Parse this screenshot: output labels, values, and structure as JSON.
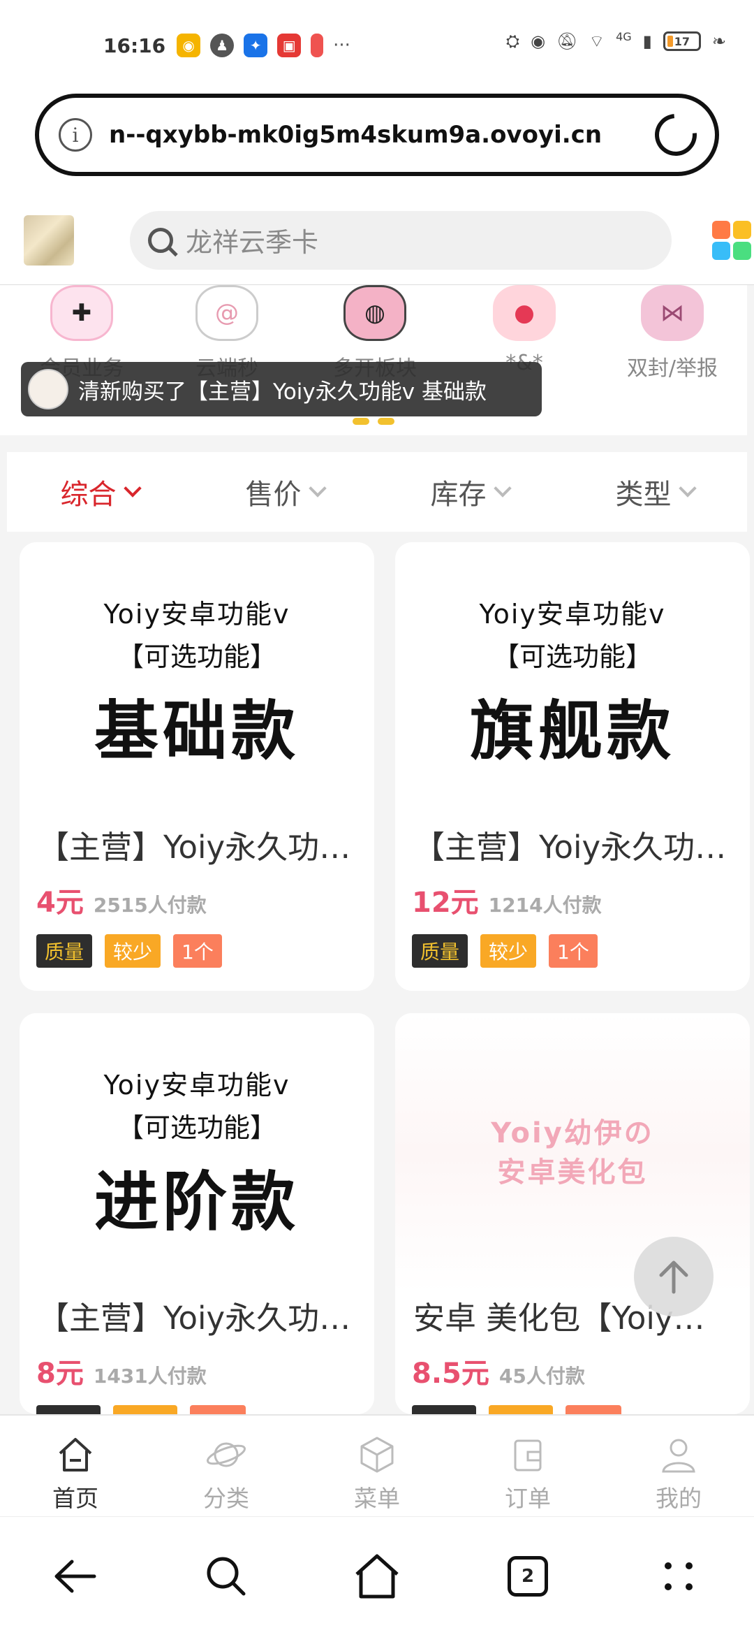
{
  "status": {
    "time": "16:16",
    "network": "4G",
    "battery": "17"
  },
  "browser": {
    "url": "n--qxybb-mk0ig5m4skum9a.ovoyi.cn",
    "tab_count": "2"
  },
  "search": {
    "placeholder": "龙祥云季卡"
  },
  "categories": [
    {
      "label": "会员业务",
      "icon": "cross-heart-icon"
    },
    {
      "label": "云端秒",
      "icon": "swirl-icon"
    },
    {
      "label": "多开板块",
      "icon": "pacifier-icon"
    },
    {
      "label": "*&*",
      "icon": "apple-icon"
    },
    {
      "label": "双封/举报",
      "icon": "bow-icon"
    }
  ],
  "toast": {
    "text": "清新购买了【主营】Yoiy永久功能v 基础款"
  },
  "sort": {
    "items": [
      "综合",
      "售价",
      "库存",
      "类型"
    ],
    "active_color": "#d9262c"
  },
  "products": [
    {
      "img_line1": "Yoiy安卓功能v",
      "img_line2": "【可选功能】",
      "img_line3": "基础款",
      "title": "【主营】Yoiy永久功能v 基础款",
      "price": "4元",
      "sold": "2515人付款",
      "tags": [
        "质量",
        "较少",
        "1个"
      ]
    },
    {
      "img_line1": "Yoiy安卓功能v",
      "img_line2": "【可选功能】",
      "img_line3": "旗舰款",
      "title": "【主营】Yoiy永久功能v 旗舰款",
      "price": "12元",
      "sold": "1214人付款",
      "tags": [
        "质量",
        "较少",
        "1个"
      ]
    },
    {
      "img_line1": "Yoiy安卓功能v",
      "img_line2": "【可选功能】",
      "img_line3": "进阶款",
      "title": "【主营】Yoiy永久功能v 进阶款",
      "price": "8元",
      "sold": "1431人付款"
    },
    {
      "img_line1": "Yoiy幼伊の",
      "img_line2": "安卓美化包",
      "title": "安卓 美化包【Yoiy幼伊】",
      "price": "8.5元",
      "sold": "45人付款"
    }
  ],
  "bottom_nav": [
    "首页",
    "分类",
    "菜单",
    "订单",
    "我的"
  ],
  "colors": {
    "price": "#e8506f",
    "tag_quality_bg": "#2e2e2e",
    "tag_less_bg": "#f9a825",
    "tag_count_bg": "#fb7f5c"
  }
}
